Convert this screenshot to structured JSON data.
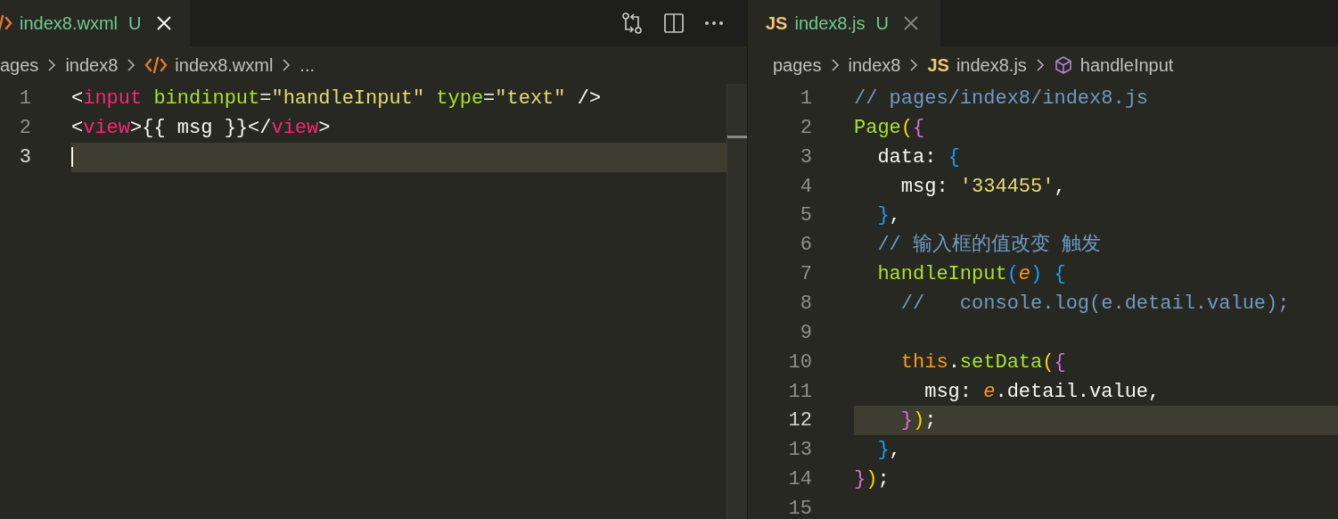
{
  "editors": [
    {
      "focused": true,
      "scrollbar": true,
      "tab": {
        "kind": "xml",
        "label": "index8.wxml",
        "status": "U",
        "selected": true
      },
      "breadcrumbs": [
        {
          "kind": "folder",
          "label": "ages"
        },
        {
          "kind": "folder",
          "label": "index8"
        },
        {
          "kind": "xml",
          "label": "index8.wxml"
        },
        {
          "kind": "more",
          "label": "..."
        }
      ],
      "lines": [
        {
          "number": "1",
          "current": false,
          "tokens": [
            {
              "kind": "punct",
              "text": "<"
            },
            {
              "kind": "tag",
              "text": "input"
            },
            {
              "kind": "attr",
              "text": " bindinput"
            },
            {
              "kind": "punct",
              "text": "="
            },
            {
              "kind": "string",
              "text": "\"handleInput\""
            },
            {
              "kind": "attr",
              "text": " type"
            },
            {
              "kind": "punct",
              "text": "="
            },
            {
              "kind": "string",
              "text": "\"text\""
            },
            {
              "kind": "punct",
              "text": " />"
            }
          ]
        },
        {
          "number": "2",
          "current": false,
          "tokens": [
            {
              "kind": "punct",
              "text": "<"
            },
            {
              "kind": "tag",
              "text": "view"
            },
            {
              "kind": "punct",
              "text": ">{{ msg }}</"
            },
            {
              "kind": "tag",
              "text": "view"
            },
            {
              "kind": "punct",
              "text": ">"
            }
          ]
        },
        {
          "number": "3",
          "current": true,
          "cursor": true
        }
      ]
    },
    {
      "focused": false,
      "scrollbar": false,
      "tab": {
        "kind": "js",
        "badge": "JS",
        "label": "index8.js",
        "status": "U",
        "selected": true
      },
      "breadcrumbs": [
        {
          "kind": "folder",
          "label": "pages"
        },
        {
          "kind": "folder",
          "label": "index8"
        },
        {
          "kind": "js",
          "badge": "JS",
          "label": "index8.js"
        },
        {
          "kind": "symbol",
          "label": "handleInput"
        }
      ],
      "lines": [
        {
          "number": "1",
          "current": false,
          "tokens": [
            {
              "kind": "comment",
              "text": "// pages/index8/index8.js"
            }
          ]
        },
        {
          "number": "2",
          "current": false,
          "tokens": [
            {
              "kind": "func",
              "text": "Page"
            },
            {
              "kind": "bracket1",
              "text": "("
            },
            {
              "kind": "bracket2",
              "text": "{"
            }
          ]
        },
        {
          "number": "3",
          "current": false,
          "tokens": [
            {
              "kind": "punct",
              "text": "  data: "
            },
            {
              "kind": "bracket3",
              "text": "{"
            }
          ]
        },
        {
          "number": "4",
          "current": false,
          "tokens": [
            {
              "kind": "punct",
              "text": "    msg: "
            },
            {
              "kind": "string",
              "text": "'334455'"
            },
            {
              "kind": "punct",
              "text": ","
            }
          ]
        },
        {
          "number": "5",
          "current": false,
          "tokens": [
            {
              "kind": "bracket3",
              "text": "  }"
            },
            {
              "kind": "punct",
              "text": ","
            }
          ]
        },
        {
          "number": "6",
          "current": false,
          "tokens": [
            {
              "kind": "comment",
              "text": "  // 输入框的值改变 触发"
            }
          ]
        },
        {
          "number": "7",
          "current": false,
          "tokens": [
            {
              "kind": "func",
              "text": "  handleInput"
            },
            {
              "kind": "bracket3",
              "text": "("
            },
            {
              "kind": "param",
              "text": "e"
            },
            {
              "kind": "bracket3",
              "text": ")"
            },
            {
              "kind": "bracket3",
              "text": " {"
            }
          ]
        },
        {
          "number": "8",
          "current": false,
          "tokens": [
            {
              "kind": "comment",
              "text": "    //   console.log(e.detail.value);"
            }
          ]
        },
        {
          "number": "9",
          "current": false
        },
        {
          "number": "10",
          "current": false,
          "tokens": [
            {
              "kind": "keyword",
              "text": "    this"
            },
            {
              "kind": "punct",
              "text": "."
            },
            {
              "kind": "func",
              "text": "setData"
            },
            {
              "kind": "bracket1",
              "text": "("
            },
            {
              "kind": "bracket2",
              "text": "{"
            }
          ]
        },
        {
          "number": "11",
          "current": false,
          "tokens": [
            {
              "kind": "punct",
              "text": "      msg: "
            },
            {
              "kind": "param",
              "text": "e"
            },
            {
              "kind": "punct",
              "text": ".detail.value,"
            }
          ]
        },
        {
          "number": "12",
          "current": true,
          "tokens": [
            {
              "kind": "bracket2",
              "text": "    }"
            },
            {
              "kind": "bracket1",
              "text": ")"
            },
            {
              "kind": "punct",
              "text": ";"
            }
          ]
        },
        {
          "number": "13",
          "current": false,
          "tokens": [
            {
              "kind": "bracket3",
              "text": "  }"
            },
            {
              "kind": "punct",
              "text": ","
            }
          ]
        },
        {
          "number": "14",
          "current": false,
          "tokens": [
            {
              "kind": "bracket2",
              "text": "}"
            },
            {
              "kind": "bracket1",
              "text": ")"
            },
            {
              "kind": "punct",
              "text": ";"
            }
          ]
        },
        {
          "number": "15",
          "current": false
        }
      ]
    }
  ]
}
